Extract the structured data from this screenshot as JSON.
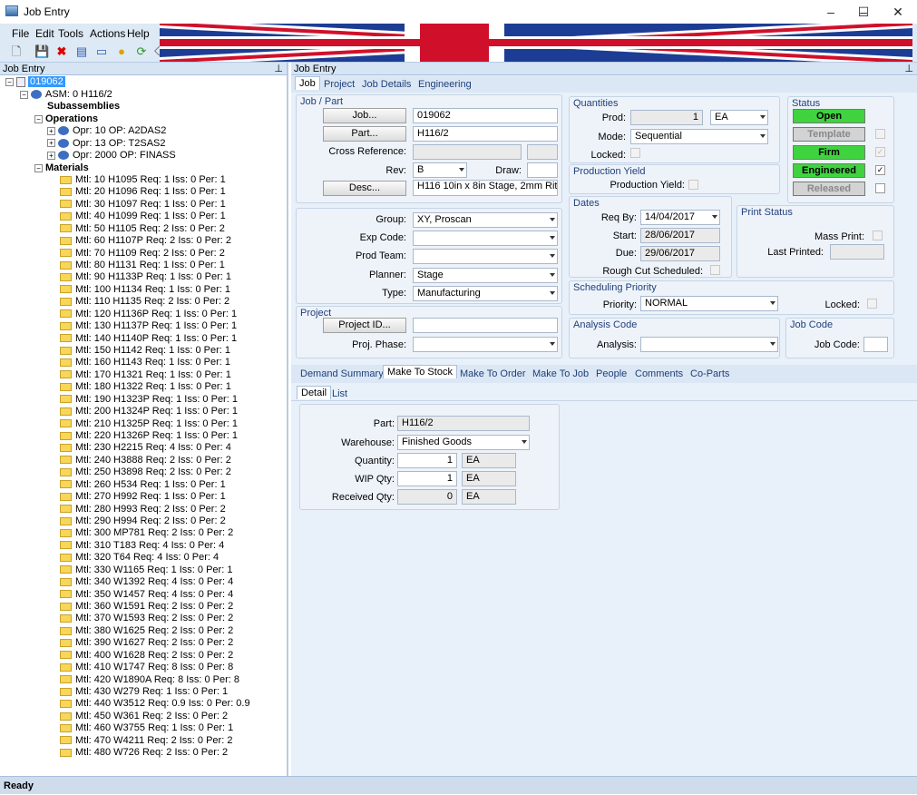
{
  "window": {
    "title": "Job Entry",
    "minimize": "–",
    "maximize": "☐",
    "close": "✕"
  },
  "menu": [
    "File",
    "Edit",
    "Tools",
    "Actions",
    "Help"
  ],
  "toolbar": {
    "job_number": "019062"
  },
  "left_pane": {
    "header": "Job Entry",
    "root": "019062",
    "assembly": "ASM: 0 H116/2",
    "subassemblies": "Subassemblies",
    "operations_label": "Operations",
    "operations": [
      "Opr: 10 OP: A2DAS2",
      "Opr: 13 OP: T2SAS2",
      "Opr: 2000 OP: FINASS"
    ],
    "materials_label": "Materials",
    "materials": [
      "Mtl: 10 H1095 Req: 1 Iss: 0 Per: 1",
      "Mtl: 20 H1096 Req: 1 Iss: 0 Per: 1",
      "Mtl: 30 H1097 Req: 1 Iss: 0 Per: 1",
      "Mtl: 40 H1099 Req: 1 Iss: 0 Per: 1",
      "Mtl: 50 H1105 Req: 2 Iss: 0 Per: 2",
      "Mtl: 60 H1107P Req: 2 Iss: 0 Per: 2",
      "Mtl: 70 H1109 Req: 2 Iss: 0 Per: 2",
      "Mtl: 80 H1131 Req: 1 Iss: 0 Per: 1",
      "Mtl: 90 H1133P Req: 1 Iss: 0 Per: 1",
      "Mtl: 100 H1134 Req: 1 Iss: 0 Per: 1",
      "Mtl: 110 H1135 Req: 2 Iss: 0 Per: 2",
      "Mtl: 120 H1136P Req: 1 Iss: 0 Per: 1",
      "Mtl: 130 H1137P Req: 1 Iss: 0 Per: 1",
      "Mtl: 140 H1140P Req: 1 Iss: 0 Per: 1",
      "Mtl: 150 H1142 Req: 1 Iss: 0 Per: 1",
      "Mtl: 160 H1143 Req: 1 Iss: 0 Per: 1",
      "Mtl: 170 H1321 Req: 1 Iss: 0 Per: 1",
      "Mtl: 180 H1322 Req: 1 Iss: 0 Per: 1",
      "Mtl: 190 H1323P Req: 1 Iss: 0 Per: 1",
      "Mtl: 200 H1324P Req: 1 Iss: 0 Per: 1",
      "Mtl: 210 H1325P Req: 1 Iss: 0 Per: 1",
      "Mtl: 220 H1326P Req: 1 Iss: 0 Per: 1",
      "Mtl: 230 H2215 Req: 4 Iss: 0 Per: 4",
      "Mtl: 240 H3888 Req: 2 Iss: 0 Per: 2",
      "Mtl: 250 H3898 Req: 2 Iss: 0 Per: 2",
      "Mtl: 260 H534 Req: 1 Iss: 0 Per: 1",
      "Mtl: 270 H992 Req: 1 Iss: 0 Per: 1",
      "Mtl: 280 H993 Req: 2 Iss: 0 Per: 2",
      "Mtl: 290 H994 Req: 2 Iss: 0 Per: 2",
      "Mtl: 300 MP781 Req: 2 Iss: 0 Per: 2",
      "Mtl: 310 T183 Req: 4 Iss: 0 Per: 4",
      "Mtl: 320 T64 Req: 4 Iss: 0 Per: 4",
      "Mtl: 330 W1165 Req: 1 Iss: 0 Per: 1",
      "Mtl: 340 W1392 Req: 4 Iss: 0 Per: 4",
      "Mtl: 350 W1457 Req: 4 Iss: 0 Per: 4",
      "Mtl: 360 W1591 Req: 2 Iss: 0 Per: 2",
      "Mtl: 370 W1593 Req: 2 Iss: 0 Per: 2",
      "Mtl: 380 W1625 Req: 2 Iss: 0 Per: 2",
      "Mtl: 390 W1627 Req: 2 Iss: 0 Per: 2",
      "Mtl: 400 W1628 Req: 2 Iss: 0 Per: 2",
      "Mtl: 410 W1747 Req: 8 Iss: 0 Per: 8",
      "Mtl: 420 W1890A Req: 8 Iss: 0 Per: 8",
      "Mtl: 430 W279 Req: 1 Iss: 0 Per: 1",
      "Mtl: 440 W3512 Req: 0.9 Iss: 0 Per: 0.9",
      "Mtl: 450 W361 Req: 2 Iss: 0 Per: 2",
      "Mtl: 460 W3755 Req: 1 Iss: 0 Per: 1",
      "Mtl: 470 W4211 Req: 2 Iss: 0 Per: 2",
      "Mtl: 480 W726 Req: 2 Iss: 0 Per: 2"
    ]
  },
  "right_pane": {
    "header": "Job Entry",
    "tabs": [
      "Job",
      "Project",
      "Job Details",
      "Engineering"
    ],
    "job_part": {
      "title": "Job / Part",
      "job_button": "Job...",
      "job_value": "019062",
      "part_button": "Part...",
      "part_value": "H116/2",
      "cross_ref_label": "Cross Reference:",
      "rev_label": "Rev:",
      "rev_value": "B",
      "draw_label": "Draw:",
      "desc_button": "Desc...",
      "desc_value": "H116 10in x 8in Stage, 2mm Rit"
    },
    "group_box": {
      "group_label": "Group:",
      "group_value": "XY, Proscan",
      "exp_code_label": "Exp Code:",
      "prod_team_label": "Prod Team:",
      "planner_label": "Planner:",
      "planner_value": "Stage",
      "type_label": "Type:",
      "type_value": "Manufacturing"
    },
    "project": {
      "title": "Project",
      "project_id_button": "Project ID...",
      "phase_label": "Proj. Phase:"
    },
    "quantities": {
      "title": "Quantities",
      "prod_label": "Prod:",
      "prod_value": "1",
      "prod_uom": "EA",
      "mode_label": "Mode:",
      "mode_value": "Sequential",
      "locked_label": "Locked:"
    },
    "production_yield": {
      "title": "Production Yield",
      "label": "Production Yield:"
    },
    "dates": {
      "title": "Dates",
      "req_by_label": "Req By:",
      "req_by_value": "14/04/2017",
      "start_label": "Start:",
      "start_value": "28/06/2017",
      "due_label": "Due:",
      "due_value": "29/06/2017",
      "rough_cut_label": "Rough Cut Scheduled:"
    },
    "status": {
      "title": "Status",
      "open": "Open",
      "template": "Template",
      "firm": "Firm",
      "engineered": "Engineered",
      "released": "Released",
      "colors": {
        "active": "#3fd43f",
        "inactive": "#d3d3d3"
      }
    },
    "print_status": {
      "title": "Print Status",
      "mass_print_label": "Mass Print:",
      "last_printed_label": "Last Printed:"
    },
    "scheduling": {
      "title": "Scheduling Priority",
      "priority_label": "Priority:",
      "priority_value": "NORMAL",
      "locked_label": "Locked:"
    },
    "analysis": {
      "title": "Analysis Code",
      "label": "Analysis:"
    },
    "job_code": {
      "title": "Job Code",
      "label": "Job Code:"
    },
    "bottom_tabs": [
      "Demand Summary",
      "Make To Stock",
      "Make To Order",
      "Make To Job",
      "People",
      "Comments",
      "Co-Parts"
    ],
    "sub_tabs": [
      "Detail",
      "List"
    ],
    "mts": {
      "part_label": "Part:",
      "part_value": "H116/2",
      "warehouse_label": "Warehouse:",
      "warehouse_value": "Finished Goods",
      "quantity_label": "Quantity:",
      "quantity_value": "1",
      "quantity_uom": "EA",
      "wip_label": "WIP Qty:",
      "wip_value": "1",
      "wip_uom": "EA",
      "received_label": "Received Qty:",
      "received_value": "0",
      "received_uom": "EA"
    }
  },
  "statusbar": {
    "text": "Ready"
  }
}
